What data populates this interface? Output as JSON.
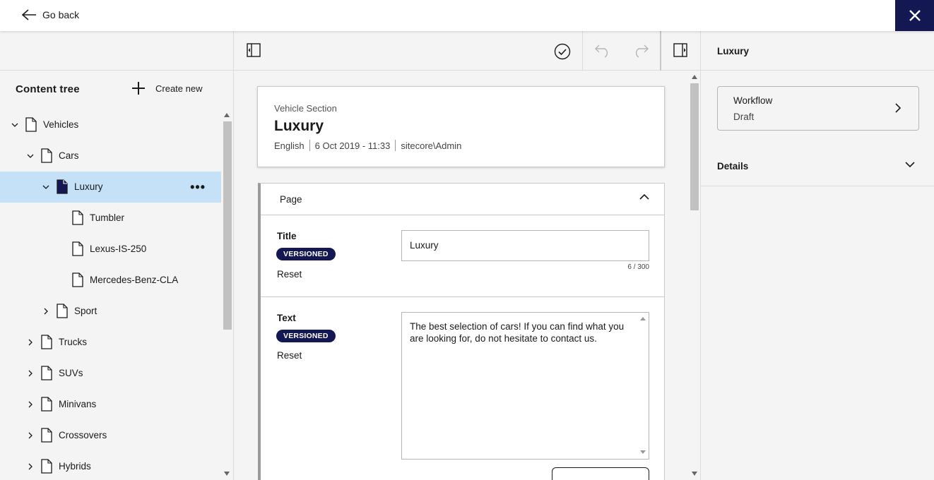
{
  "topbar": {
    "go_back_label": "Go back"
  },
  "tree": {
    "title": "Content tree",
    "create_new_label": "Create new",
    "items": [
      {
        "label": "Vehicles",
        "depth": 0,
        "expanded": true
      },
      {
        "label": "Cars",
        "depth": 1,
        "expanded": true
      },
      {
        "label": "Luxury",
        "depth": 2,
        "expanded": true,
        "selected": true
      },
      {
        "label": "Tumbler",
        "depth": 3
      },
      {
        "label": "Lexus-IS-250",
        "depth": 3
      },
      {
        "label": "Mercedes-Benz-CLA",
        "depth": 3
      },
      {
        "label": "Sport",
        "depth": 2,
        "expanded": false
      },
      {
        "label": "Trucks",
        "depth": 1,
        "expanded": false
      },
      {
        "label": "SUVs",
        "depth": 1,
        "expanded": false
      },
      {
        "label": "Minivans",
        "depth": 1,
        "expanded": false
      },
      {
        "label": "Crossovers",
        "depth": 1,
        "expanded": false
      },
      {
        "label": "Hybrids",
        "depth": 1,
        "expanded": false
      }
    ]
  },
  "item": {
    "template": "Vehicle Section",
    "name": "Luxury",
    "language": "English",
    "date": "6 Oct 2019 - 11:33",
    "author": "sitecore\\Admin"
  },
  "section": {
    "title": "Page",
    "fields": {
      "title": {
        "label": "Title",
        "badge": "VERSIONED",
        "reset": "Reset",
        "value": "Luxury",
        "counter": "6 / 300"
      },
      "text": {
        "label": "Text",
        "badge": "VERSIONED",
        "reset": "Reset",
        "value": "The best selection of cars! If you can find what you are looking for, do not hesitate to contact us."
      }
    }
  },
  "right_panel": {
    "title": "Luxury",
    "workflow_label": "Workflow",
    "workflow_state": "Draft",
    "details_label": "Details"
  },
  "colors": {
    "brand": "#141852",
    "selected_row": "#c4e1f7",
    "background": "#f4f4f4"
  }
}
